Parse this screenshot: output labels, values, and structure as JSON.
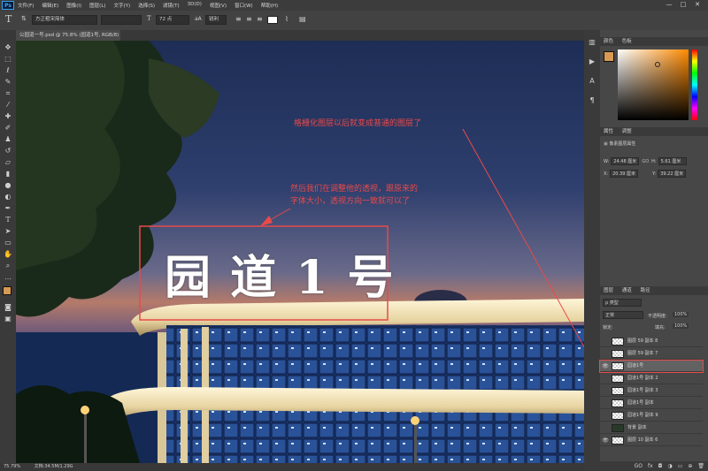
{
  "app": {
    "logo": "Ps"
  },
  "menu": [
    "文件(F)",
    "编辑(E)",
    "图像(I)",
    "图层(L)",
    "文字(Y)",
    "选择(S)",
    "滤镜(T)",
    "3D(D)",
    "视图(V)",
    "窗口(W)",
    "帮助(H)"
  ],
  "window_controls": [
    "—",
    "□",
    "✕"
  ],
  "options": {
    "font_family": "方正粗宋简体",
    "font_style": "",
    "font_size": "72 点",
    "aa_icon": "aA",
    "antialias": "锐利"
  },
  "document": {
    "tab": "公园道一号.psd @ 75.8% (园道1号, RGB/8) *",
    "close": "×"
  },
  "canvas": {
    "sign_text": "园 道 1 号",
    "annotation_top": "格栅化图层以后就变成普通的图层了",
    "annotation_mid_1": "然后我们在调整他的透视，跟原来的",
    "annotation_mid_2": "字体大小，透视方向一致就可以了"
  },
  "status": {
    "zoom": "75.79%",
    "doc": "文档:34.5M/1.29G"
  },
  "color_panel": {
    "tabs": [
      "颜色",
      "色板"
    ],
    "foreground": "#d89a52"
  },
  "properties_panel": {
    "tabs": [
      "属性",
      "调整"
    ],
    "title": "像素图层属性",
    "w_label": "W:",
    "w_value": "24.48 厘米",
    "link_icon": "GO",
    "h_label": "H:",
    "h_value": "5.61 厘米",
    "x_label": "X:",
    "x_value": "20.39 厘米",
    "y_label": "Y:",
    "y_value": "39.22 厘米"
  },
  "layers_panel": {
    "tabs": [
      "图层",
      "通道",
      "路径"
    ],
    "filter_kind": "ρ 类型",
    "blend_mode": "正常",
    "opacity_label": "不透明度:",
    "opacity_value": "100%",
    "lock_label": "锁定:",
    "fill_label": "填充:",
    "fill_value": "100%",
    "layers": [
      {
        "name": "图层 59 副本 8",
        "visible": false
      },
      {
        "name": "图层 59 副本 7",
        "visible": false
      },
      {
        "name": "园道1号",
        "visible": true
      },
      {
        "name": "园道1号 副本 2",
        "visible": false
      },
      {
        "name": "园道1号 副本 3",
        "visible": false
      },
      {
        "name": "园道1号 副本",
        "visible": false
      },
      {
        "name": "园道1号 副本 9",
        "visible": false
      },
      {
        "name": "背景 副本",
        "visible": false
      },
      {
        "name": "图层 10 副本 6",
        "visible": true
      }
    ],
    "footer_icons": [
      "GO",
      "fx",
      "◘",
      "◑",
      "▭",
      "⊕",
      "🗑"
    ]
  }
}
